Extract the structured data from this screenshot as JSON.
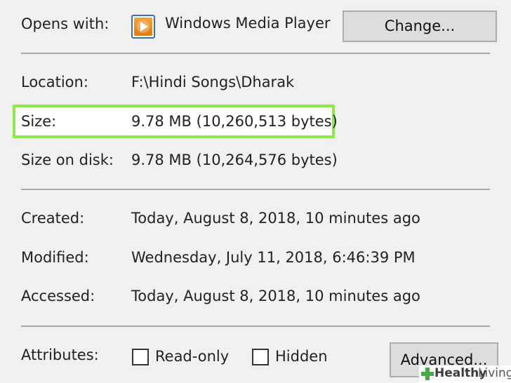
{
  "opens_with": {
    "label": "Opens with:",
    "app_name": "Windows Media Player",
    "change_button": "Change..."
  },
  "location": {
    "label": "Location:",
    "value": "F:\\Hindi Songs\\Dharak"
  },
  "size": {
    "label": "Size:",
    "value": "9.78 MB (10,260,513 bytes)"
  },
  "size_on_disk": {
    "label": "Size on disk:",
    "value": "9.78 MB (10,264,576 bytes)"
  },
  "created": {
    "label": "Created:",
    "value": "Today, August 8, 2018, 10 minutes ago"
  },
  "modified": {
    "label": "Modified:",
    "value": "Wednesday, July 11, 2018, 6:46:39 PM"
  },
  "accessed": {
    "label": "Accessed:",
    "value": "Today, August 8, 2018, 10 minutes ago"
  },
  "attributes": {
    "label": "Attributes:",
    "read_only": {
      "label": "Read-only",
      "checked": false
    },
    "hidden": {
      "label": "Hidden",
      "checked": false
    },
    "advanced_button": "Advanced..."
  },
  "watermark": {
    "word1": "Healthy",
    "word2": "Living"
  },
  "colors": {
    "highlight": "#8ee84a",
    "background": "#f0f0f0",
    "wmp_orange": "#f08c1e"
  }
}
